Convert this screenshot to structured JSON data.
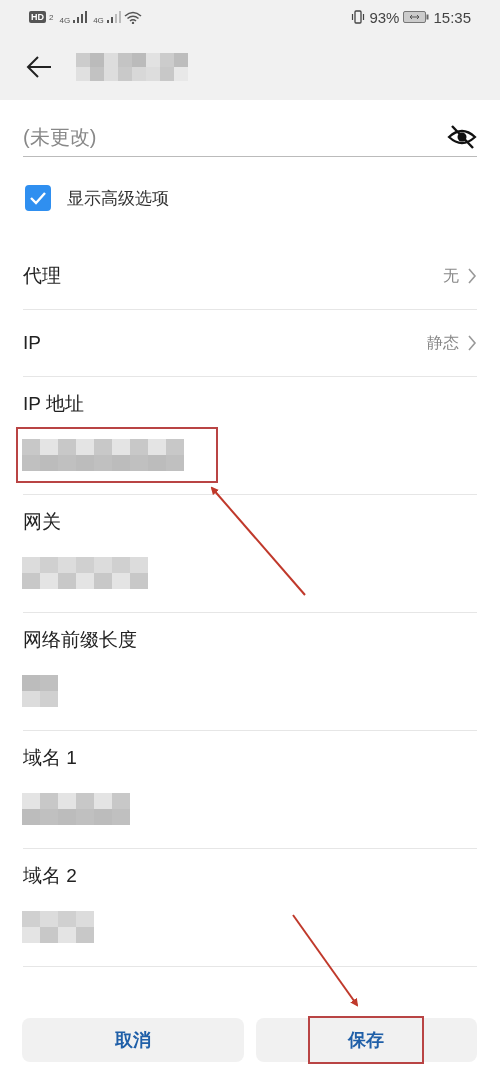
{
  "status_bar": {
    "hd": "HD",
    "sim": "2",
    "networks": [
      "4G",
      "4G"
    ],
    "battery": "93%",
    "time": "15:35"
  },
  "header": {
    "title_hidden": true
  },
  "password": {
    "placeholder": "(未更改)",
    "visible": false
  },
  "advanced": {
    "label": "显示高级选项",
    "checked": true
  },
  "settings": [
    {
      "label": "代理",
      "value": "无"
    },
    {
      "label": "IP",
      "value": "静态"
    }
  ],
  "fields": [
    {
      "label": "IP 地址",
      "value_hidden": true,
      "highlighted": true
    },
    {
      "label": "网关",
      "value_hidden": true,
      "highlighted": false
    },
    {
      "label": "网络前缀长度",
      "value_hidden": true,
      "highlighted": false
    },
    {
      "label": "域名 1",
      "value_hidden": true,
      "highlighted": false
    },
    {
      "label": "域名 2",
      "value_hidden": true,
      "highlighted": false
    }
  ],
  "buttons": [
    {
      "label": "取消",
      "highlighted": false
    },
    {
      "label": "保存",
      "highlighted": true
    }
  ],
  "annotations": [
    {
      "kind": "arrow"
    },
    {
      "kind": "arrow"
    }
  ]
}
